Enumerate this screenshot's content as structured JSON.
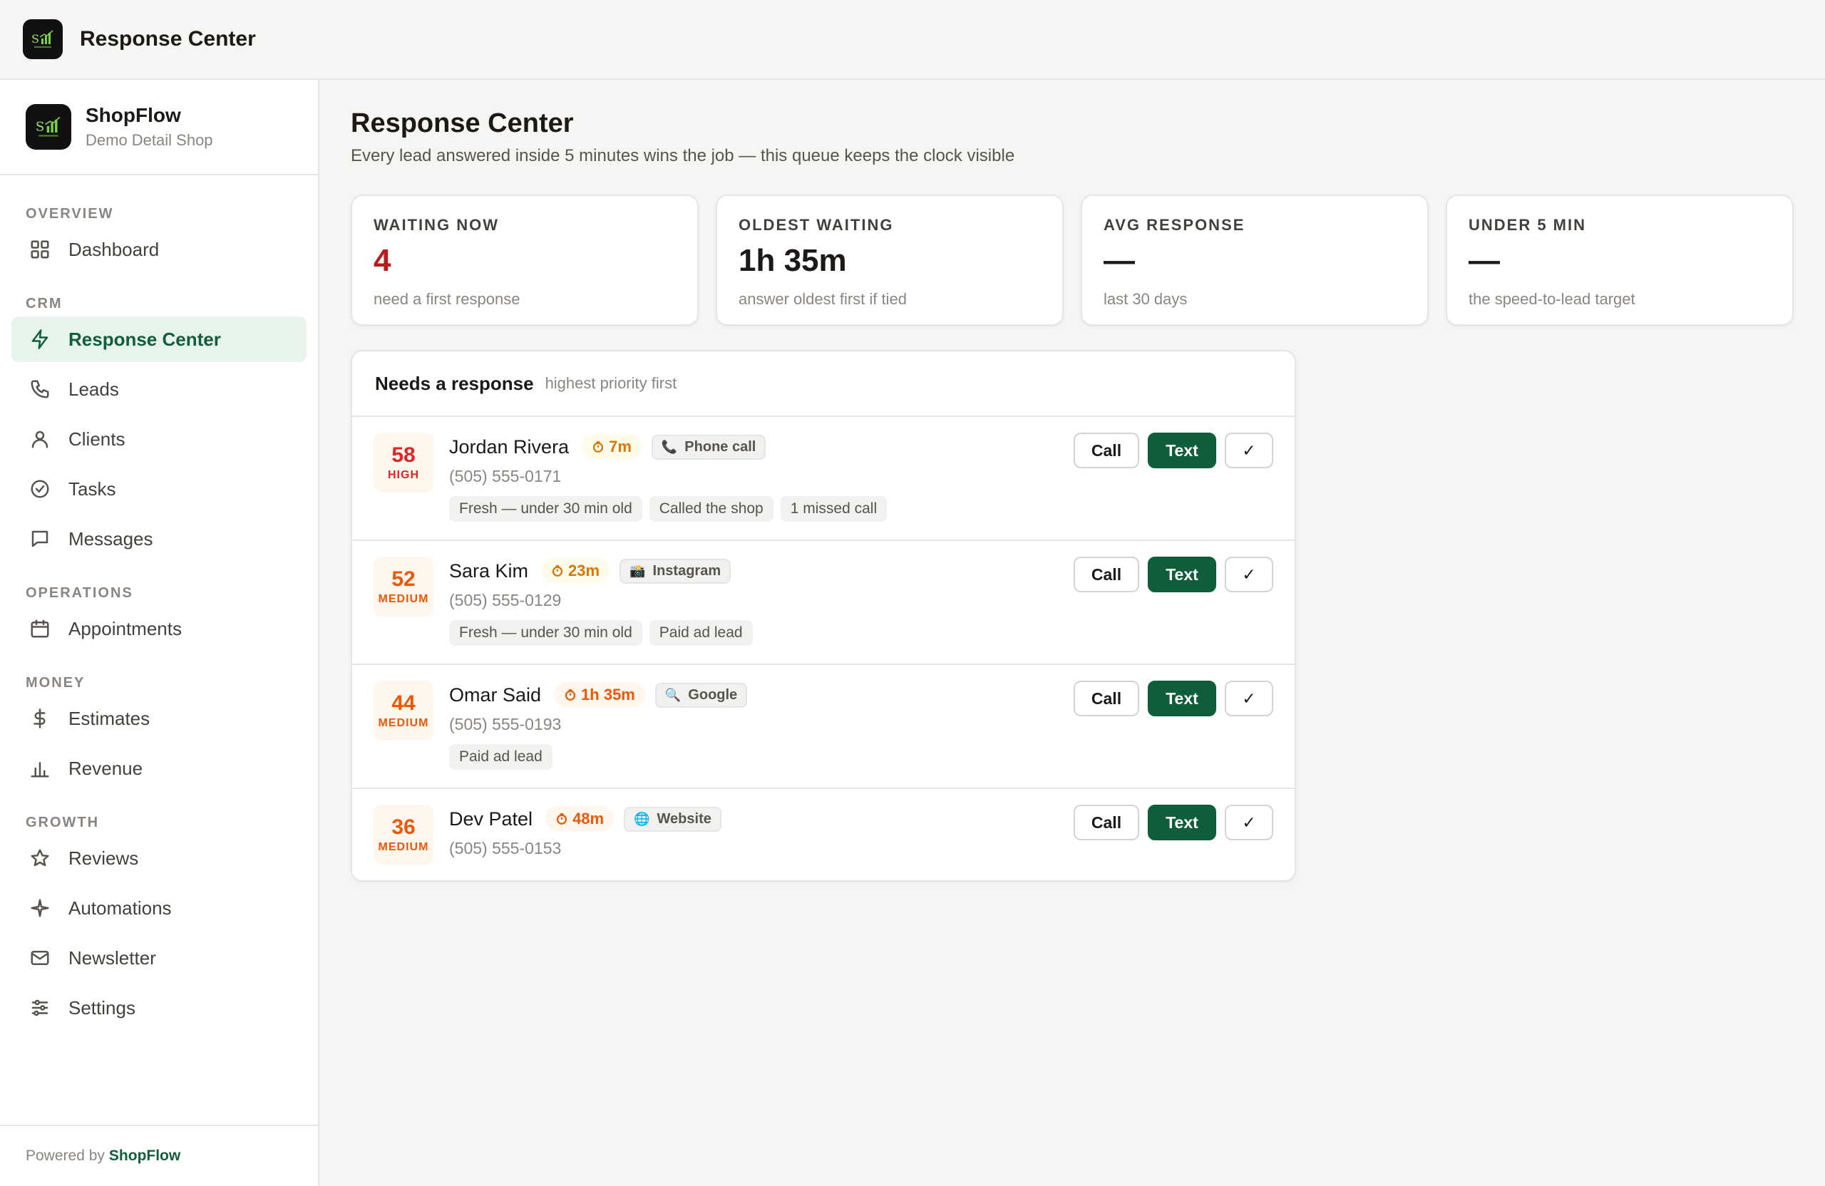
{
  "topbar": {
    "title": "Response Center"
  },
  "brand": {
    "name": "ShopFlow",
    "subtitle": "Demo Detail Shop"
  },
  "nav": {
    "sections": {
      "overview": "OVERVIEW",
      "crm": "CRM",
      "operations": "OPERATIONS",
      "money": "MONEY",
      "growth": "GROWTH"
    },
    "items": {
      "dashboard": "Dashboard",
      "response_center": "Response Center",
      "leads": "Leads",
      "clients": "Clients",
      "tasks": "Tasks",
      "messages": "Messages",
      "appointments": "Appointments",
      "estimates": "Estimates",
      "revenue": "Revenue",
      "reviews": "Reviews",
      "automations": "Automations",
      "newsletter": "Newsletter",
      "settings": "Settings"
    },
    "active": "Response Center"
  },
  "footer": {
    "powered_prefix": "Powered by",
    "powered_brand": "ShopFlow"
  },
  "page": {
    "title": "Response Center",
    "subtitle": "Every lead answered inside 5 minutes wins the job — this queue keeps the clock visible"
  },
  "stats": [
    {
      "label": "WAITING NOW",
      "value": "4",
      "hint": "need a first response",
      "color": "#b91c1c"
    },
    {
      "label": "OLDEST WAITING",
      "value": "1h 35m",
      "hint": "answer oldest first if tied"
    },
    {
      "label": "AVG RESPONSE",
      "value": "—",
      "hint": "last 30 days"
    },
    {
      "label": "UNDER 5 MIN",
      "value": "—",
      "hint": "the speed-to-lead target"
    }
  ],
  "queue": {
    "title": "Needs a response",
    "subtitle": "highest priority first",
    "actions": {
      "call": "Call",
      "text": "Text",
      "done": "✓"
    },
    "leads": [
      {
        "score": "58",
        "level": "HIGH",
        "name": "Jordan Rivera",
        "wait": "7m",
        "source": "Phone call",
        "source_icon": "phone-icon",
        "phone": "(505) 555-0171",
        "tags": [
          "Fresh — under 30 min old",
          "Called the shop",
          "1 missed call"
        ]
      },
      {
        "score": "52",
        "level": "MEDIUM",
        "name": "Sara Kim",
        "wait": "23m",
        "source": "Instagram",
        "source_icon": "camera-icon",
        "phone": "(505) 555-0129",
        "tags": [
          "Fresh — under 30 min old",
          "Paid ad lead"
        ]
      },
      {
        "score": "44",
        "level": "MEDIUM",
        "name": "Omar Said",
        "wait": "1h 35m",
        "source": "Google",
        "source_icon": "magnifier-icon",
        "phone": "(505) 555-0193",
        "tags": [
          "Paid ad lead"
        ]
      },
      {
        "score": "36",
        "level": "MEDIUM",
        "name": "Dev Patel",
        "wait": "48m",
        "source": "Website",
        "source_icon": "globe-icon",
        "phone": "(505) 555-0153",
        "tags": []
      }
    ]
  },
  "colors": {
    "accent": "#0f5e3a",
    "active_bg": "#e6f4ec",
    "high": "#dc2626",
    "medium": "#ea580c"
  }
}
